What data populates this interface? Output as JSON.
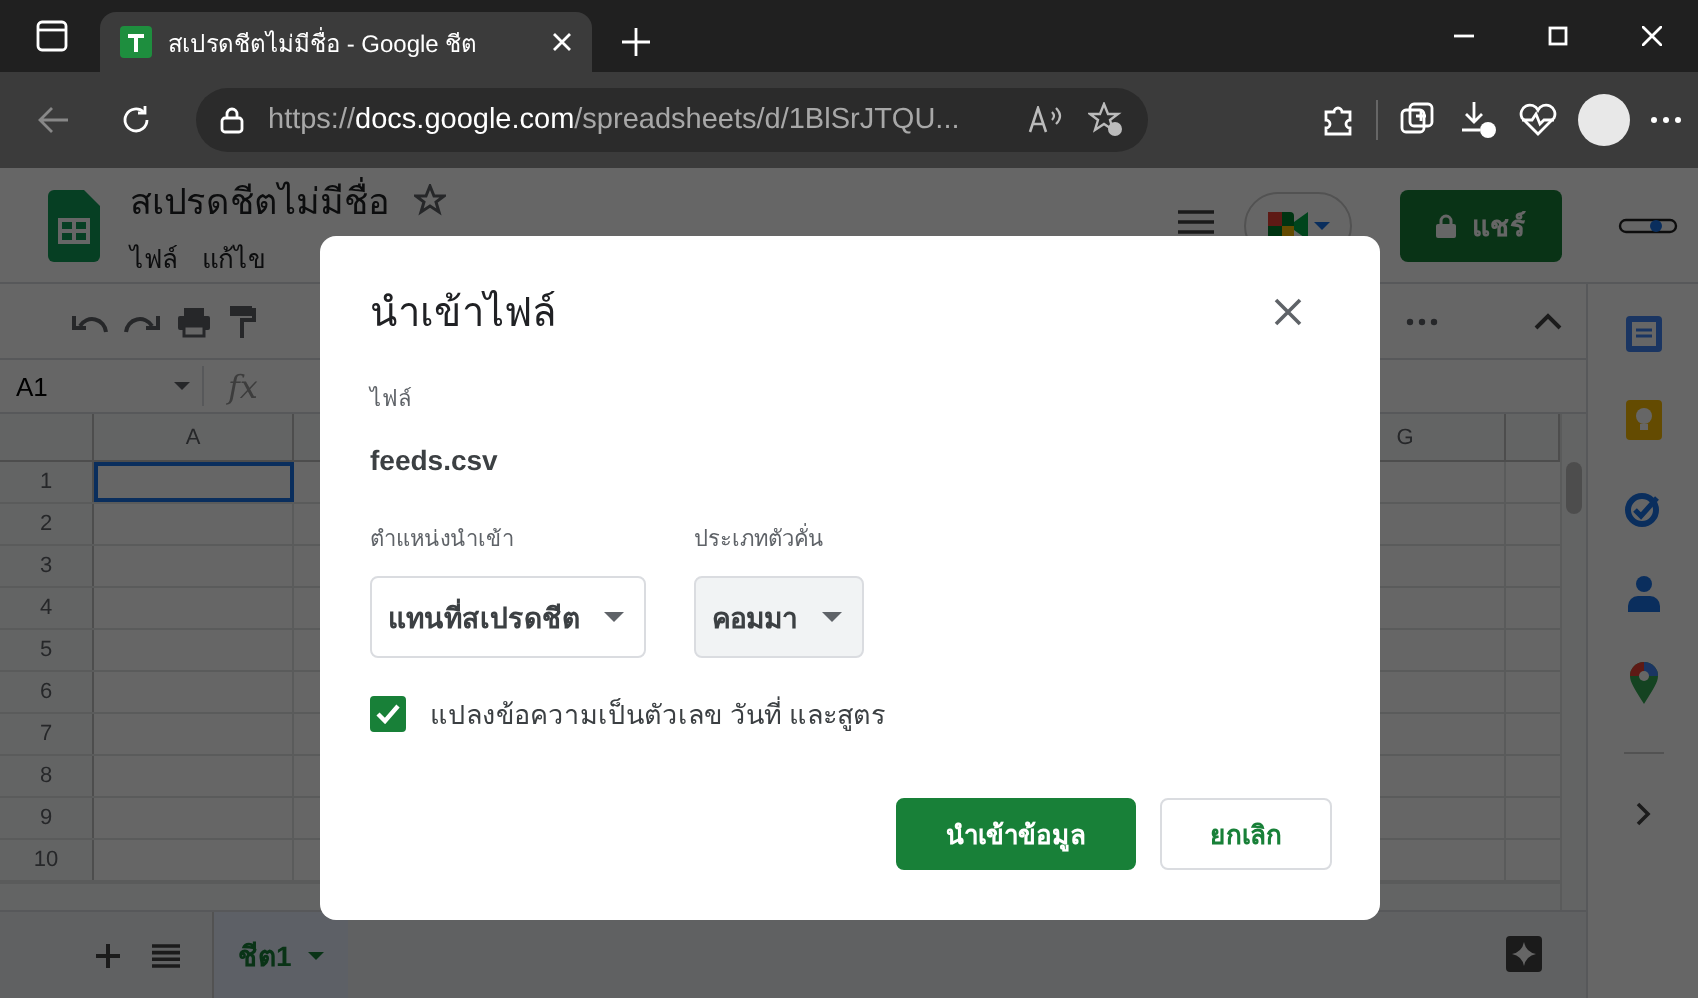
{
  "browser": {
    "tab": {
      "title": "สเปรดชีตไม่มีชื่อ - Google ชีต"
    },
    "address": {
      "scheme": "https://",
      "host": "docs.google.com",
      "path": "/spreadsheets/d/1BlSrJTQU..."
    }
  },
  "app": {
    "title": "สเปรดชีตไม่มีชื่อ",
    "menus": [
      "ไฟล์",
      "แก้ไข"
    ],
    "share_button": "แชร์",
    "name_box": "A1",
    "formula_label": "fx",
    "columns": [
      "A",
      "G"
    ],
    "rows": [
      {
        "label": "1",
        "selected": true
      },
      {
        "label": "2",
        "selected": false
      },
      {
        "label": "3",
        "selected": false
      },
      {
        "label": "4",
        "selected": false
      },
      {
        "label": "5",
        "selected": false
      },
      {
        "label": "6",
        "selected": false
      },
      {
        "label": "7",
        "selected": false
      },
      {
        "label": "8",
        "selected": false
      },
      {
        "label": "9",
        "selected": false
      },
      {
        "label": "10",
        "selected": false
      }
    ],
    "sheet_tabs": [
      {
        "label": "ชีต1",
        "selected": true
      }
    ]
  },
  "dialog": {
    "title": "นำเข้าไฟล์",
    "file_label": "ไฟล์",
    "file_name": "feeds.csv",
    "fields": [
      {
        "label": "ตำแหน่งนำเข้า",
        "value": "แทนที่สเปรดชีต",
        "highlighted": false
      },
      {
        "label": "ประเภทตัวคั่น",
        "value": "คอมมา",
        "highlighted": true
      }
    ],
    "checkbox": {
      "label": "แปลงข้อความเป็นตัวเลข วันที่ และสูตร",
      "checked": true
    },
    "buttons": [
      {
        "label": "นำเข้าข้อมูล",
        "kind": "primary"
      },
      {
        "label": "ยกเลิก",
        "kind": "secondary"
      }
    ]
  }
}
